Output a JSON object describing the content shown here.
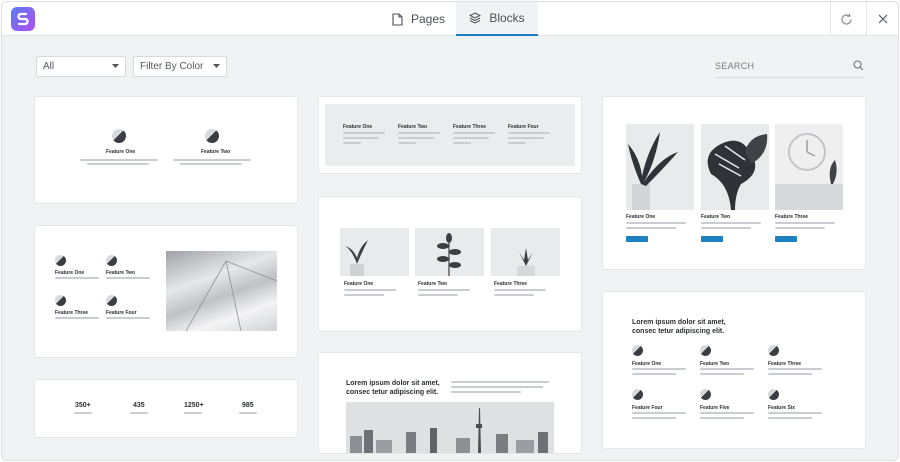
{
  "header": {
    "tabs": [
      {
        "label": "Pages",
        "icon": "page-icon"
      },
      {
        "label": "Blocks",
        "icon": "layers-icon"
      }
    ],
    "active_tab": "Blocks"
  },
  "filters": {
    "category": "All",
    "color": "Filter By Color",
    "search_placeholder": "SEARCH"
  },
  "colors": {
    "accent": "#1d80c0",
    "background": "#f1f2f4"
  },
  "blocks": {
    "b1": {
      "items": [
        "Feature One",
        "Feature Two"
      ]
    },
    "b2": {
      "items": [
        "Feature One",
        "Feature Two",
        "Feature Three",
        "Feature Four"
      ]
    },
    "b3": {
      "stats": [
        "350+",
        "435",
        "1250+",
        "985"
      ]
    },
    "b4": {
      "items": [
        "Feature One",
        "Feature Two",
        "Feature Three",
        "Feature Four"
      ]
    },
    "b5": {
      "items": [
        "Feature One",
        "Feature Two",
        "Feature Three"
      ]
    },
    "b6": {
      "title_line1": "Lorem ipsum dolor sit amet,",
      "title_line2": "consec tetur adipiscing elit."
    },
    "b7": {
      "items": [
        "Feature One",
        "Feature Two",
        "Feature Three"
      ]
    },
    "b8": {
      "title_line1": "Lorem ipsum dolor sit amet,",
      "title_line2": "consec tetur adipiscing elit.",
      "items": [
        "Feature One",
        "Feature Two",
        "Feature Three",
        "Feature Four",
        "Feature Five",
        "Feature Six"
      ]
    }
  }
}
